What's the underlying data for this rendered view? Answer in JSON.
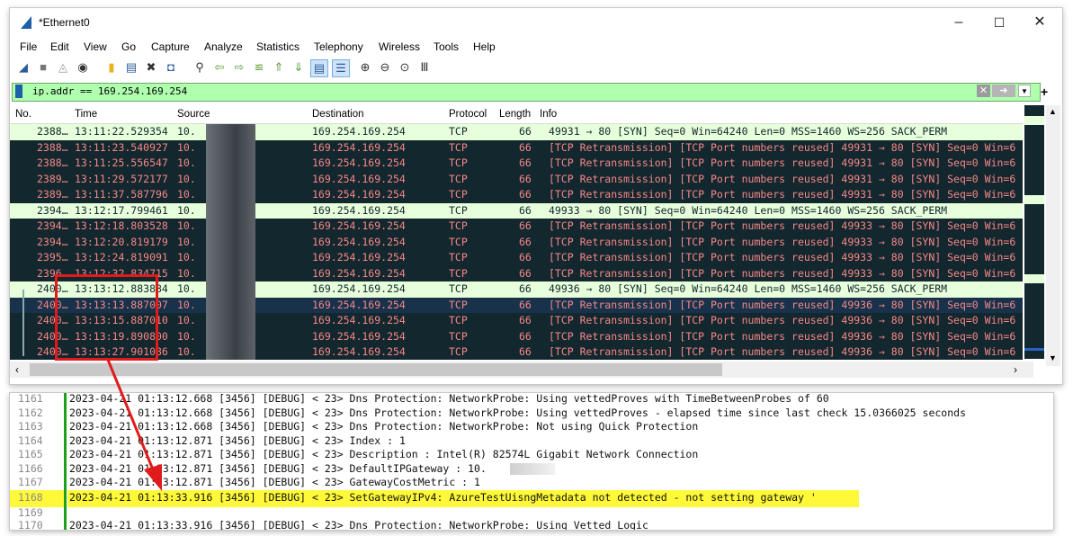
{
  "window": {
    "title": "*Ethernet0",
    "controls": {
      "minimize": "–",
      "maximize": "☐",
      "close": "✕"
    }
  },
  "menu": [
    "File",
    "Edit",
    "View",
    "Go",
    "Capture",
    "Analyze",
    "Statistics",
    "Telephony",
    "Wireless",
    "Tools",
    "Help"
  ],
  "toolbar_icons": [
    "shark-start-icon",
    "stop-icon",
    "restart-icon",
    "options-icon",
    "open-icon",
    "save-icon",
    "close-file-icon",
    "reload-icon",
    "find-icon",
    "back-icon",
    "forward-icon",
    "goto-icon",
    "first-icon",
    "last-icon",
    "autoscroll-icon",
    "colorize-icon",
    "zoom-in-icon",
    "zoom-out-icon",
    "zoom-normal-icon",
    "resize-columns-icon"
  ],
  "filter": {
    "value": "ip.addr == 169.254.169.254",
    "plus": "+"
  },
  "columns": [
    "No.",
    "Time",
    "Source",
    "Destination",
    "Protocol",
    "Length",
    "Info"
  ],
  "packets": [
    {
      "no": "2388…",
      "time": "13:11:22.529354",
      "source": "10.",
      "dest": "169.254.169.254",
      "proto": "TCP",
      "len": "66",
      "info": "49931 → 80 [SYN] Seq=0 Win=64240 Len=0 MSS=1460 WS=256 SACK_PERM",
      "kind": "syn"
    },
    {
      "no": "2388…",
      "time": "13:11:23.540927",
      "source": "10.",
      "dest": "169.254.169.254",
      "proto": "TCP",
      "len": "66",
      "info": "[TCP Retransmission] [TCP Port numbers reused] 49931 → 80 [SYN] Seq=0 Win=6",
      "kind": "retx"
    },
    {
      "no": "2388…",
      "time": "13:11:25.556547",
      "source": "10.",
      "dest": "169.254.169.254",
      "proto": "TCP",
      "len": "66",
      "info": "[TCP Retransmission] [TCP Port numbers reused] 49931 → 80 [SYN] Seq=0 Win=6",
      "kind": "retx"
    },
    {
      "no": "2389…",
      "time": "13:11:29.572177",
      "source": "10.",
      "dest": "169.254.169.254",
      "proto": "TCP",
      "len": "66",
      "info": "[TCP Retransmission] [TCP Port numbers reused] 49931 → 80 [SYN] Seq=0 Win=6",
      "kind": "retx"
    },
    {
      "no": "2389…",
      "time": "13:11:37.587796",
      "source": "10.",
      "dest": "169.254.169.254",
      "proto": "TCP",
      "len": "66",
      "info": "[TCP Retransmission] [TCP Port numbers reused] 49931 → 80 [SYN] Seq=0 Win=6",
      "kind": "retx"
    },
    {
      "no": "2394…",
      "time": "13:12:17.799461",
      "source": "10.",
      "dest": "169.254.169.254",
      "proto": "TCP",
      "len": "66",
      "info": "49933 → 80 [SYN] Seq=0 Win=64240 Len=0 MSS=1460 WS=256 SACK_PERM",
      "kind": "syn"
    },
    {
      "no": "2394…",
      "time": "13:12:18.803528",
      "source": "10.",
      "dest": "169.254.169.254",
      "proto": "TCP",
      "len": "66",
      "info": "[TCP Retransmission] [TCP Port numbers reused] 49933 → 80 [SYN] Seq=0 Win=6",
      "kind": "retx"
    },
    {
      "no": "2394…",
      "time": "13:12:20.819179",
      "source": "10.",
      "dest": "169.254.169.254",
      "proto": "TCP",
      "len": "66",
      "info": "[TCP Retransmission] [TCP Port numbers reused] 49933 → 80 [SYN] Seq=0 Win=6",
      "kind": "retx"
    },
    {
      "no": "2395…",
      "time": "13:12:24.819091",
      "source": "10.",
      "dest": "169.254.169.254",
      "proto": "TCP",
      "len": "66",
      "info": "[TCP Retransmission] [TCP Port numbers reused] 49933 → 80 [SYN] Seq=0 Win=6",
      "kind": "retx"
    },
    {
      "no": "2396…",
      "time": "13:12:32.834715",
      "source": "10.",
      "dest": "169.254.169.254",
      "proto": "TCP",
      "len": "66",
      "info": "[TCP Retransmission] [TCP Port numbers reused] 49933 → 80 [SYN] Seq=0 Win=6",
      "kind": "retx"
    },
    {
      "no": "2400…",
      "time": "13:13:12.883884",
      "source": "10.",
      "dest": "169.254.169.254",
      "proto": "TCP",
      "len": "66",
      "info": "49936 → 80 [SYN] Seq=0 Win=64240 Len=0 MSS=1460 WS=256 SACK_PERM",
      "kind": "syn"
    },
    {
      "no": "2400…",
      "time": "13:13:13.887007",
      "source": "10.",
      "dest": "169.254.169.254",
      "proto": "TCP",
      "len": "66",
      "info": "[TCP Retransmission] [TCP Port numbers reused] 49936 → 80 [SYN] Seq=0 Win=6",
      "kind": "sel"
    },
    {
      "no": "2400…",
      "time": "13:13:15.887010",
      "source": "10.",
      "dest": "169.254.169.254",
      "proto": "TCP",
      "len": "66",
      "info": "[TCP Retransmission] [TCP Port numbers reused] 49936 → 80 [SYN] Seq=0 Win=6",
      "kind": "retx"
    },
    {
      "no": "2400…",
      "time": "13:13:19.890800",
      "source": "10.",
      "dest": "169.254.169.254",
      "proto": "TCP",
      "len": "66",
      "info": "[TCP Retransmission] [TCP Port numbers reused] 49936 → 80 [SYN] Seq=0 Win=6",
      "kind": "retx"
    },
    {
      "no": "2400…",
      "time": "13:13:27.901086",
      "source": "10.",
      "dest": "169.254.169.254",
      "proto": "TCP",
      "len": "66",
      "info": "[TCP Retransmission] [TCP Port numbers reused] 49936 → 80 [SYN] Seq=0 Win=6",
      "kind": "retx"
    }
  ],
  "log": [
    {
      "ln": "1161",
      "text": "2023-04-21 01:13:12.668 [3456] [DEBUG] < 23> Dns Protection: NetworkProbe: Using vettedProves with TimeBetweenProbes of 60"
    },
    {
      "ln": "1162",
      "text": "2023-04-21 01:13:12.668 [3456] [DEBUG] < 23> Dns Protection: NetworkProbe: Using vettedProves - elapsed time since last check 15.0366025 seconds"
    },
    {
      "ln": "1163",
      "text": "2023-04-21 01:13:12.668 [3456] [DEBUG] < 23> Dns Protection: NetworkProbe: Not using Quick Protection"
    },
    {
      "ln": "1164",
      "text": "2023-04-21 01:13:12.871 [3456] [DEBUG] < 23> Index : 1"
    },
    {
      "ln": "1165",
      "text": "2023-04-21 01:13:12.871 [3456] [DEBUG] < 23> Description : Intel(R) 82574L Gigabit Network Connection"
    },
    {
      "ln": "1166",
      "text": "2023-04-21 01:13:12.871 [3456] [DEBUG] < 23> DefaultIPGateway : 10."
    },
    {
      "ln": "1167",
      "text": "2023-04-21 01:13:12.871 [3456] [DEBUG] < 23> GatewayCostMetric : 1"
    },
    {
      "ln": "1168",
      "text": "2023-04-21 01:13:33.916 [3456] [DEBUG] < 23> SetGatewayIPv4: AzureTestUisngMetadata not detected - not setting gateway '"
    },
    {
      "ln": "1169",
      "text": ""
    },
    {
      "ln": "1170",
      "text": "2023-04-21 01:13:33.916 [3456] [DEBUG] < 23> Dns Protection: NetworkProbe: Using Vetted Logic"
    }
  ],
  "colors": {
    "syn_bg": "#e7ffdb",
    "retx_bg": "#12272e",
    "retx_fg": "#f78787",
    "filter_bg": "#afffaf",
    "highlight": "#fff93a",
    "annotation": "#e11b1b"
  }
}
